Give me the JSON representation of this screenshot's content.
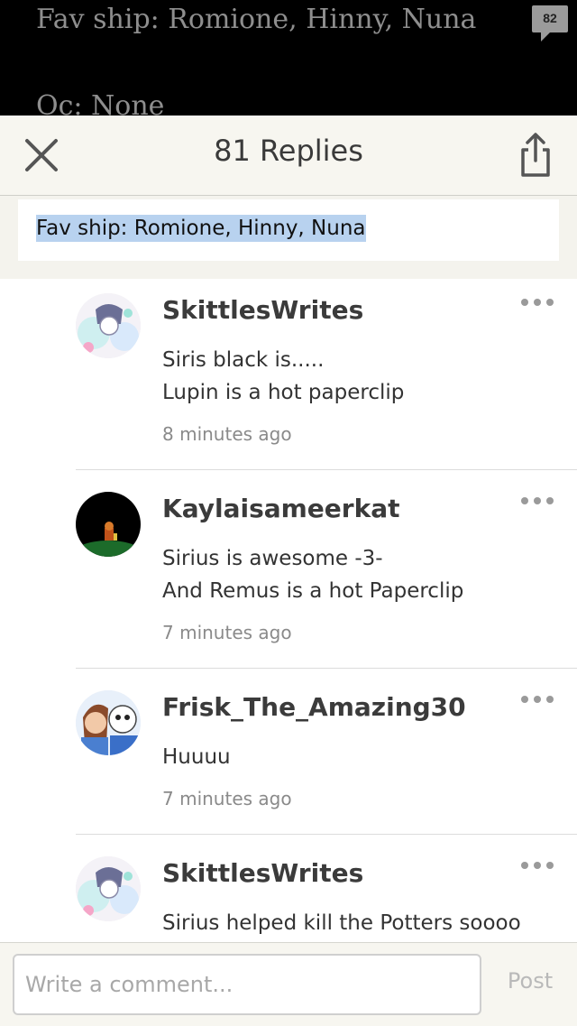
{
  "background_story": {
    "line1": "Fav ship: Romione, Hinny, Nuna",
    "line2": "Oc: None",
    "comment_count": "82"
  },
  "header": {
    "title": "81 Replies",
    "close_icon": "close-icon",
    "share_icon": "share-icon"
  },
  "quote": {
    "text": "Fav ship: Romione, Hinny, Nuna"
  },
  "replies": [
    {
      "author": "SkittlesWrites",
      "lines": [
        "Siris black is.....",
        "Lupin is a hot paperclip"
      ],
      "time": "8 minutes ago"
    },
    {
      "author": "Kaylaisameerkat",
      "lines": [
        "Sirius is awesome -3-",
        "And Remus is a hot Paperclip"
      ],
      "time": "7 minutes ago"
    },
    {
      "author": "Frisk_The_Amazing30",
      "lines": [
        "Huuuu"
      ],
      "time": "7 minutes ago"
    },
    {
      "author": "SkittlesWrites",
      "lines": [
        "Sirius helped kill the Potters soooo"
      ],
      "time": ""
    }
  ],
  "composer": {
    "placeholder": "Write a comment...",
    "post_label": "Post"
  }
}
